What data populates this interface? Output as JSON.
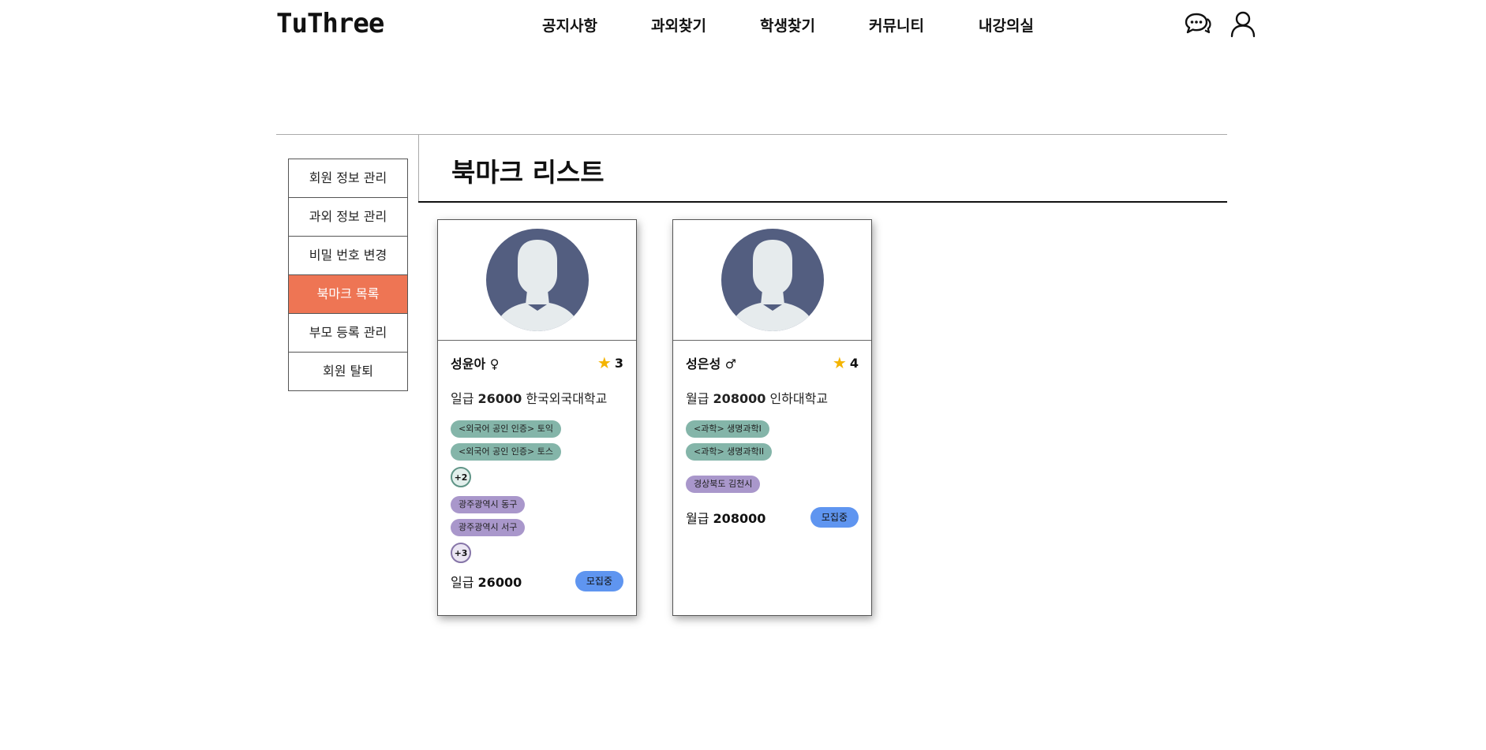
{
  "header": {
    "logo": "TuThree",
    "nav": [
      {
        "label": "공지사항"
      },
      {
        "label": "과외찾기"
      },
      {
        "label": "학생찾기"
      },
      {
        "label": "커뮤니티"
      },
      {
        "label": "내강의실"
      }
    ],
    "icons": [
      "chat-icon",
      "user-icon"
    ]
  },
  "sidebar": {
    "items": [
      {
        "label": "회원 정보 관리"
      },
      {
        "label": "과외 정보 관리"
      },
      {
        "label": "비밀 번호 변경"
      },
      {
        "label": "북마크 목록"
      },
      {
        "label": "부모 등록 관리"
      },
      {
        "label": "회원 탈퇴"
      }
    ],
    "active_index": 3
  },
  "main": {
    "title": "북마크 리스트"
  },
  "cards": [
    {
      "name": "성윤아 ♀",
      "rating": "3",
      "pay_type": "일급",
      "pay_amount": "26000",
      "school": "한국외국대학교",
      "subjects": [
        "<외국어 공인 인증> 토익",
        "<외국어 공인 인증> 토스"
      ],
      "subjects_more": "+2",
      "regions": [
        "광주광역시 동구",
        "광주광역시 서구"
      ],
      "regions_more": "+3",
      "bottom_pay_type": "일급",
      "bottom_pay_amount": "26000",
      "status": "모집중"
    },
    {
      "name": "성은성 ♂",
      "rating": "4",
      "pay_type": "월급",
      "pay_amount": "208000",
      "school": "인하대학교",
      "subjects": [
        "<과학> 생명과학I",
        "<과학> 생명과학II"
      ],
      "regions": [
        "경상북도 김천시"
      ],
      "bottom_pay_type": "월급",
      "bottom_pay_amount": "208000",
      "status": "모집중"
    }
  ],
  "colors": {
    "active_menu": "#ee7554",
    "subject_chip": "#84b5a9",
    "region_chip": "#a997cb",
    "status_badge": "#5f95f0",
    "star": "#f4b400",
    "avatar_bg": "#535e80"
  }
}
